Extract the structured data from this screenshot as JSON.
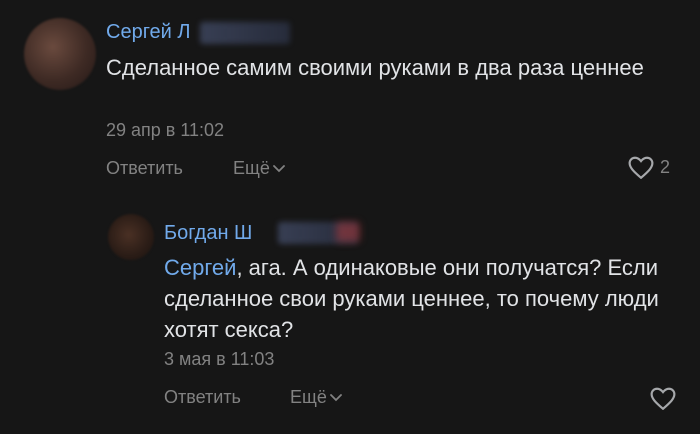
{
  "comments": [
    {
      "author": "Сергей Л",
      "text": "Сделанное самим своими руками в два раза ценнее",
      "time": "29 апр в 11:02",
      "reply_label": "Ответить",
      "more_label": "Ещё",
      "likes": "2"
    },
    {
      "author": "Богдан Ш",
      "mention": "Сергей",
      "text": ", ага. А одинаковые они получатся? Если сделанное свои руками ценнее, то почему люди хотят секса?",
      "time": "3 мая в 11:03",
      "reply_label": "Ответить",
      "more_label": "Ещё"
    }
  ],
  "colors": {
    "background": "#161616",
    "link": "#71aaeb",
    "secondary": "#828282",
    "text": "#e1e3e6"
  },
  "icons": [
    "heart-outline-icon",
    "chevron-down-icon"
  ]
}
